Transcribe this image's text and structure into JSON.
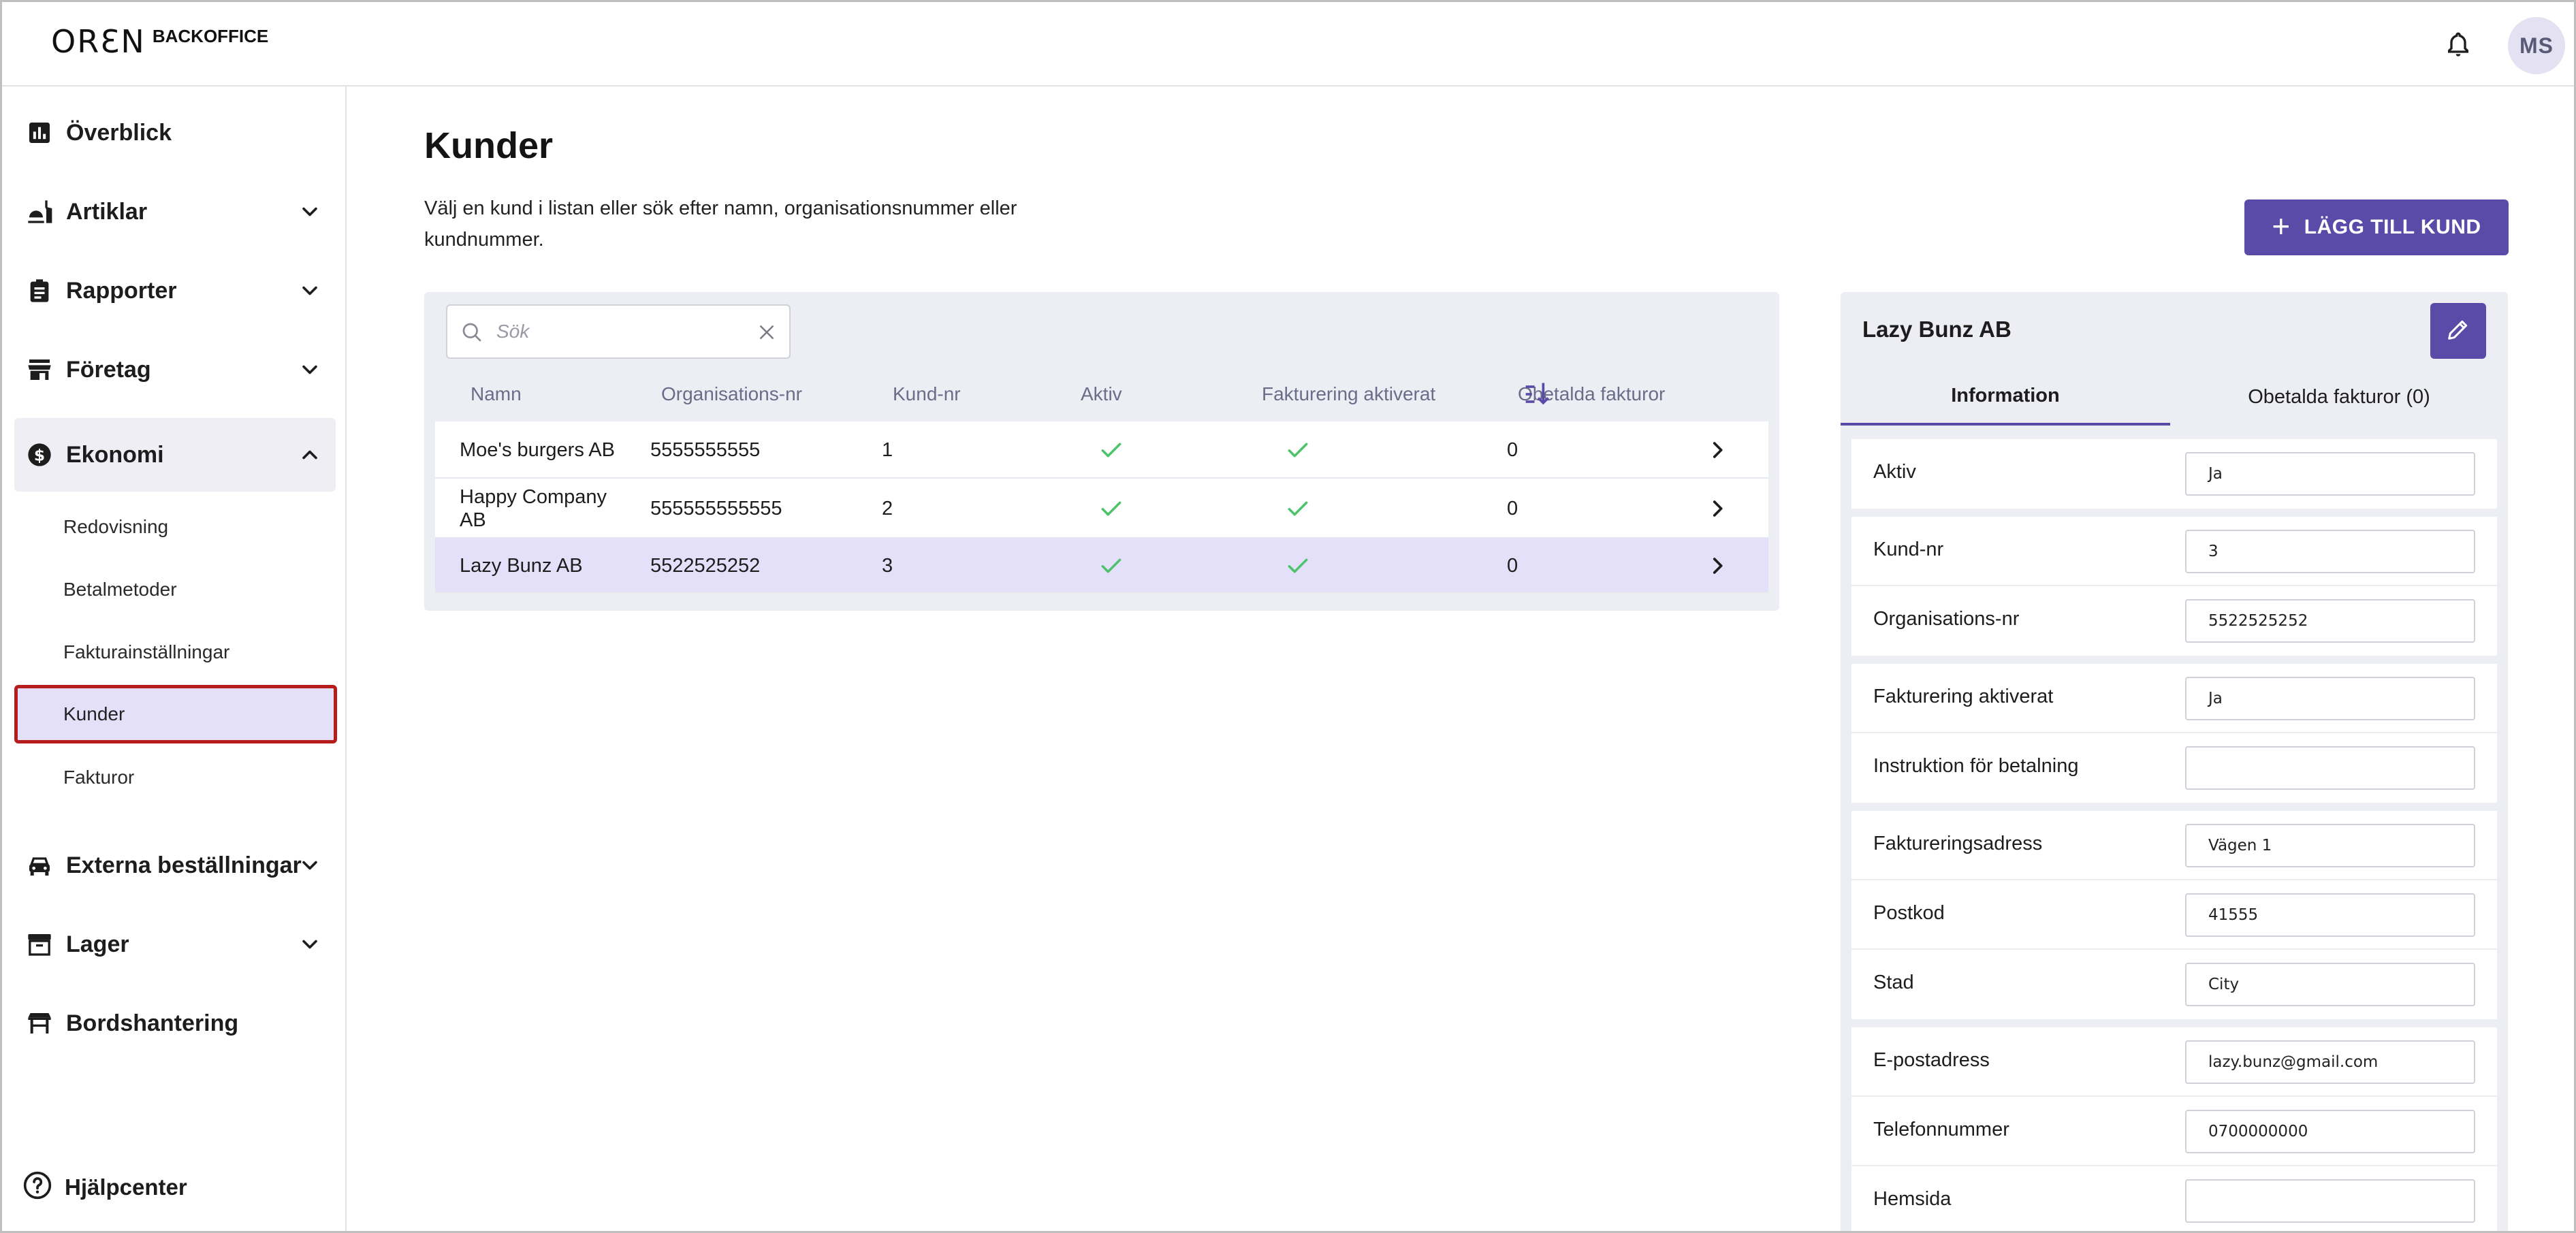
{
  "header": {
    "logo_mark": "ORƐN",
    "logo_text": "BACKOFFICE",
    "notifications_icon": "bell-icon",
    "user_initials": "MS"
  },
  "sidebar": {
    "items": [
      {
        "label": "Överblick",
        "icon": "bar-chart-icon",
        "expandable": false
      },
      {
        "label": "Artiklar",
        "icon": "food-icon",
        "expandable": true
      },
      {
        "label": "Rapporter",
        "icon": "clipboard-icon",
        "expandable": true
      },
      {
        "label": "Företag",
        "icon": "store-icon",
        "expandable": true
      },
      {
        "label": "Ekonomi",
        "icon": "dollar-icon",
        "expandable": true,
        "expanded": true
      },
      {
        "label": "Externa beställningar",
        "icon": "car-icon",
        "expandable": true
      },
      {
        "label": "Lager",
        "icon": "archive-icon",
        "expandable": true
      },
      {
        "label": "Bordshantering",
        "icon": "table-icon",
        "expandable": false
      }
    ],
    "ekonomi_sub": [
      {
        "label": "Redovisning"
      },
      {
        "label": "Betalmetoder"
      },
      {
        "label": "Fakturainställningar"
      },
      {
        "label": "Kunder",
        "active": true
      },
      {
        "label": "Fakturor"
      }
    ],
    "help_label": "Hjälpcenter"
  },
  "main": {
    "title": "Kunder",
    "description": "Välj en kund i listan eller sök efter namn, organisationsnummer eller kundnummer.",
    "add_button_label": "LÄGG TILL KUND",
    "search_placeholder": "Sök",
    "columns": [
      "Namn",
      "Organisations-nr",
      "Kund-nr",
      "Aktiv",
      "Fakturering aktiverat",
      "Obetalda fakturor"
    ],
    "rows": [
      {
        "name": "Moe's burgers AB",
        "org_nr": "5555555555",
        "kund_nr": "1",
        "aktiv": true,
        "fakturering": true,
        "obetalda": "0"
      },
      {
        "name": "Happy Company AB",
        "org_nr": "555555555555",
        "kund_nr": "2",
        "aktiv": true,
        "fakturering": true,
        "obetalda": "0"
      },
      {
        "name": "Lazy Bunz AB",
        "org_nr": "5522525252",
        "kund_nr": "3",
        "aktiv": true,
        "fakturering": true,
        "obetalda": "0",
        "selected": true
      }
    ]
  },
  "detail": {
    "title": "Lazy Bunz AB",
    "tabs": [
      "Information",
      "Obetalda fakturor (0)"
    ],
    "groups": [
      [
        {
          "label": "Aktiv",
          "value": "Ja"
        }
      ],
      [
        {
          "label": "Kund-nr",
          "value": "3"
        },
        {
          "label": "Organisations-nr",
          "value": "5522525252"
        }
      ],
      [
        {
          "label": "Fakturering aktiverat",
          "value": "Ja"
        },
        {
          "label": "Instruktion för betalning",
          "value": ""
        }
      ],
      [
        {
          "label": "Faktureringsadress",
          "value": "Vägen 1"
        },
        {
          "label": "Postkod",
          "value": "41555"
        },
        {
          "label": "Stad",
          "value": "City"
        }
      ],
      [
        {
          "label": "E-postadress",
          "value": "lazy.bunz@gmail.com"
        },
        {
          "label": "Telefonnummer",
          "value": "0700000000"
        },
        {
          "label": "Hemsida",
          "value": ""
        }
      ]
    ]
  },
  "colors": {
    "accent": "#5b4ba8",
    "selected_row": "#e4e0fa",
    "check_green": "#4cc36a",
    "active_outline": "#b71c1c"
  }
}
